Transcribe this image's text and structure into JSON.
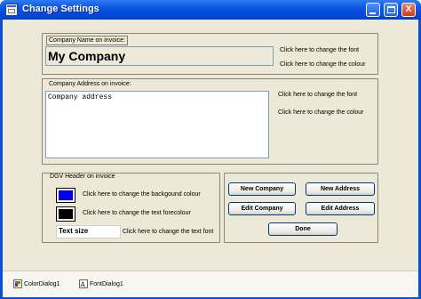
{
  "window": {
    "title": "Change Settings",
    "controls": {
      "minimize": "",
      "maximize": "",
      "close": "X"
    }
  },
  "company_name": {
    "legend": "Company Name on invoice:",
    "value": "My Company",
    "change_font": "Click here to change the font",
    "change_colour": "Click here to change the colour"
  },
  "company_address": {
    "legend": "Company Address on invoice:",
    "value": "Company address",
    "change_font": "Click here to change the font",
    "change_colour": "Click here to change the colour"
  },
  "dgv_header": {
    "legend": "DGV Header on invoice",
    "background_label": "Click here to change the backgound colour",
    "forecolour_label": "Click here to change the text forecolour",
    "textsize_value": "Text size",
    "textfont_label": "Click here to change the text font",
    "colors": {
      "background_swatch": "#0000ee",
      "forecolour_swatch": "#000000"
    }
  },
  "buttons": {
    "new_company": "New Company",
    "new_address": "New Address",
    "edit_company": "Edit Company",
    "edit_address": "Edit Address",
    "done": "Done"
  },
  "component_tray": [
    {
      "label": "ColorDialog1",
      "icon": "color-dialog-icon"
    },
    {
      "label": "FontDialog1",
      "icon": "font-dialog-icon"
    }
  ]
}
